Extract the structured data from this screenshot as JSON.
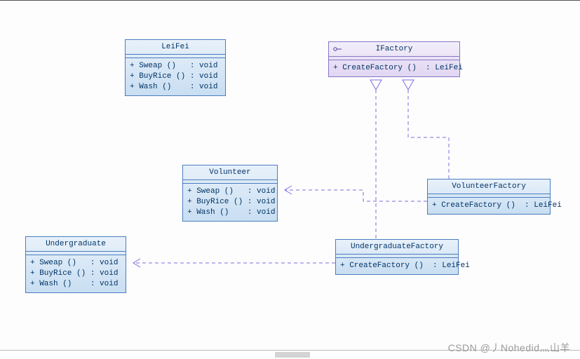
{
  "chart_data": {
    "type": "uml_class_diagram",
    "classes": [
      {
        "id": "LeiFei",
        "name": "LeiFei",
        "stereotype": "class",
        "operations": [
          {
            "vis": "+",
            "name": "Sweap",
            "params": "",
            "ret": "void"
          },
          {
            "vis": "+",
            "name": "BuyRice",
            "params": "",
            "ret": "void"
          },
          {
            "vis": "+",
            "name": "Wash",
            "params": "",
            "ret": "void"
          }
        ]
      },
      {
        "id": "IFactory",
        "name": "IFactory",
        "stereotype": "interface",
        "operations": [
          {
            "vis": "+",
            "name": "CreateFactory",
            "params": "",
            "ret": "LeiFei"
          }
        ]
      },
      {
        "id": "Volunteer",
        "name": "Volunteer",
        "stereotype": "class",
        "operations": [
          {
            "vis": "+",
            "name": "Sweap",
            "params": "",
            "ret": "void"
          },
          {
            "vis": "+",
            "name": "BuyRice",
            "params": "",
            "ret": "void"
          },
          {
            "vis": "+",
            "name": "Wash",
            "params": "",
            "ret": "void"
          }
        ]
      },
      {
        "id": "Undergraduate",
        "name": "Undergraduate",
        "stereotype": "class",
        "operations": [
          {
            "vis": "+",
            "name": "Sweap",
            "params": "",
            "ret": "void"
          },
          {
            "vis": "+",
            "name": "BuyRice",
            "params": "",
            "ret": "void"
          },
          {
            "vis": "+",
            "name": "Wash",
            "params": "",
            "ret": "void"
          }
        ]
      },
      {
        "id": "VolunteerFactory",
        "name": "VolunteerFactory",
        "stereotype": "class",
        "operations": [
          {
            "vis": "+",
            "name": "CreateFactory",
            "params": "",
            "ret": "LeiFei"
          }
        ]
      },
      {
        "id": "UndergraduateFactory",
        "name": "UndergraduateFactory",
        "stereotype": "class",
        "operations": [
          {
            "vis": "+",
            "name": "CreateFactory",
            "params": "",
            "ret": "LeiFei"
          }
        ]
      }
    ],
    "relations": [
      {
        "from": "VolunteerFactory",
        "to": "IFactory",
        "type": "realization"
      },
      {
        "from": "UndergraduateFactory",
        "to": "IFactory",
        "type": "realization"
      },
      {
        "from": "VolunteerFactory",
        "to": "Volunteer",
        "type": "dependency"
      },
      {
        "from": "UndergraduateFactory",
        "to": "Undergraduate",
        "type": "dependency"
      }
    ]
  },
  "boxes": {
    "leifei": {
      "title": "LeiFei",
      "op1": "+ Sweap ()   : void",
      "op2": "+ BuyRice () : void",
      "op3": "+ Wash ()    : void"
    },
    "ifactory": {
      "title": "IFactory",
      "op1": "+ CreateFactory ()  : LeiFei"
    },
    "volunteer": {
      "title": "Volunteer",
      "op1": "+ Sweap ()   : void",
      "op2": "+ BuyRice () : void",
      "op3": "+ Wash ()    : void"
    },
    "undergraduate": {
      "title": "Undergraduate",
      "op1": "+ Sweap ()   : void",
      "op2": "+ BuyRice () : void",
      "op3": "+ Wash ()    : void"
    },
    "volunteerfactory": {
      "title": "VolunteerFactory",
      "op1": "+ CreateFactory ()  : LeiFei"
    },
    "undergraduatefactory": {
      "title": "UndergraduateFactory",
      "op1": "+ CreateFactory ()  : LeiFei"
    }
  },
  "watermark": "CSDN @丿Nohedid灬山羊"
}
